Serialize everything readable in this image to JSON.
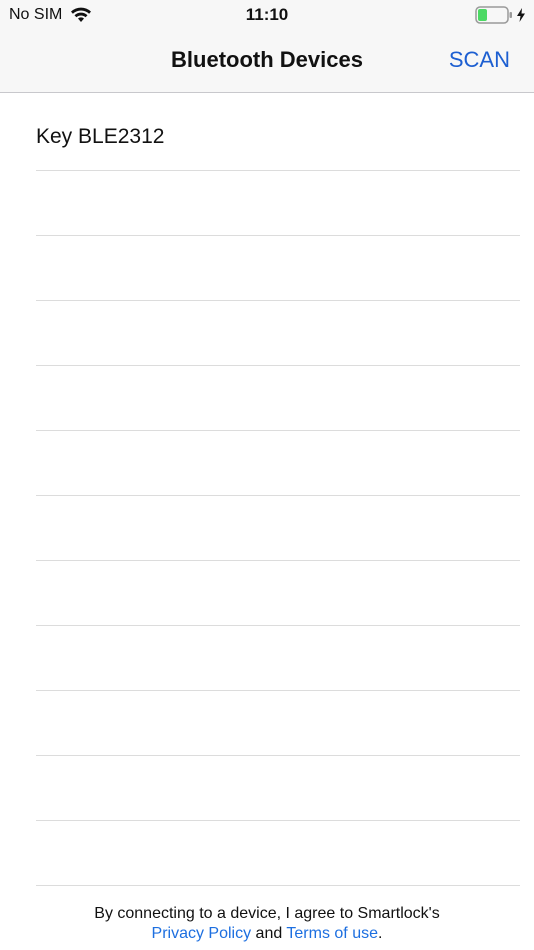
{
  "status_bar": {
    "carrier": "No SIM",
    "time": "11:10",
    "wifi_icon": "wifi-icon",
    "battery_icon": "battery-icon",
    "charging_icon": "charging-bolt-icon",
    "battery_color": "#4cd964"
  },
  "nav": {
    "title": "Bluetooth Devices",
    "scan_label": "SCAN",
    "accent_color": "#1d5fd1"
  },
  "devices": [
    {
      "name": "Key BLE2312"
    },
    {
      "name": ""
    },
    {
      "name": ""
    },
    {
      "name": ""
    },
    {
      "name": ""
    },
    {
      "name": ""
    },
    {
      "name": ""
    },
    {
      "name": ""
    },
    {
      "name": ""
    },
    {
      "name": ""
    },
    {
      "name": ""
    },
    {
      "name": ""
    }
  ],
  "footer": {
    "line1": "By connecting to a device, I agree to Smartlock's",
    "privacy_label": "Privacy Policy",
    "and_text": " and ",
    "terms_label": "Terms of use",
    "end_text": "."
  }
}
